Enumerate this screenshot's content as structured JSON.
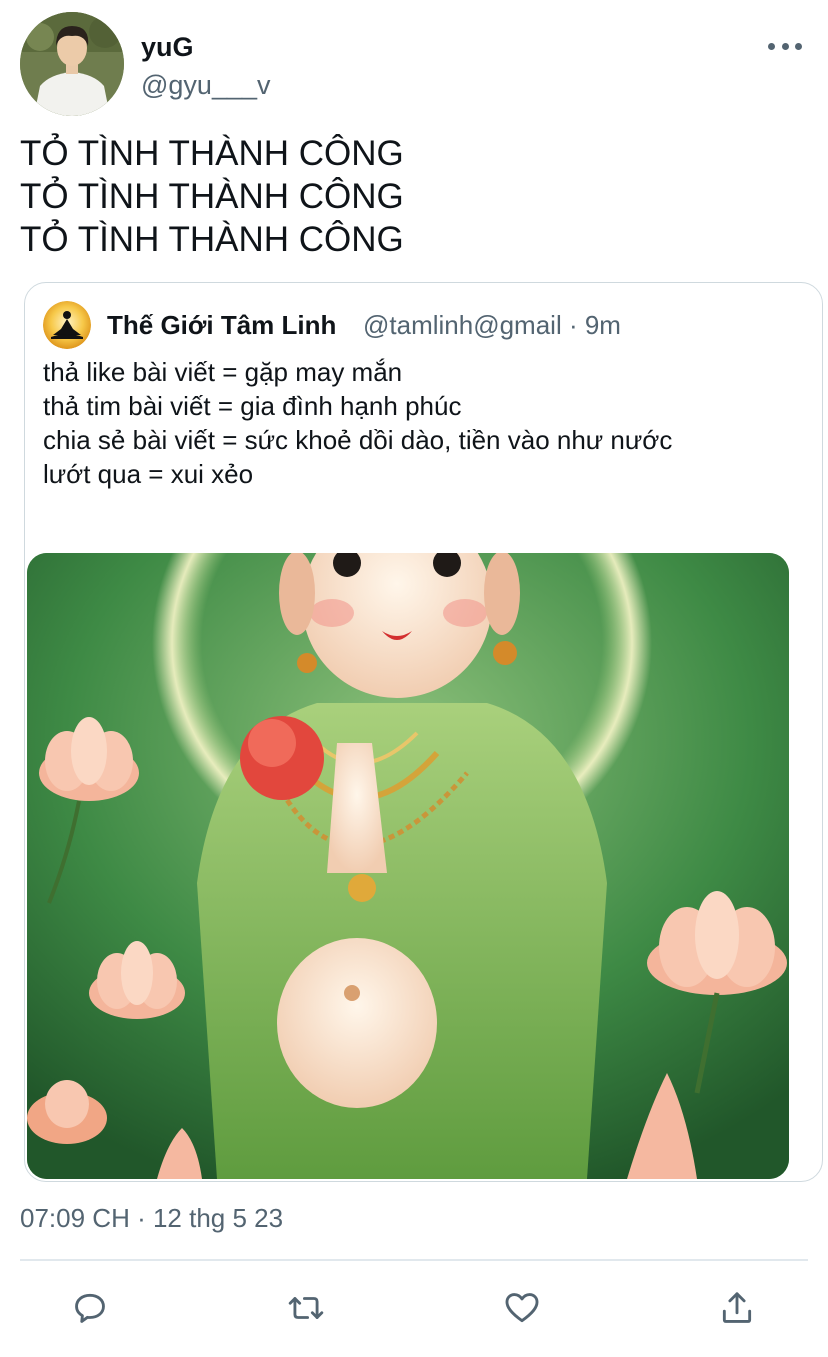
{
  "author": {
    "name": "yuG",
    "handle": "@gyu___v"
  },
  "tweet": {
    "lines": [
      "TỎ TÌNH THÀNH CÔNG",
      "TỎ TÌNH THÀNH CÔNG",
      "TỎ TÌNH THÀNH CÔNG"
    ]
  },
  "quoted": {
    "name": "Thế Giới Tâm Linh",
    "handle_time": "@tamlinh@gmail · 9m",
    "lines": [
      "thả like bài viết = gặp may mắn",
      "thả tim bài viết = gia đình hạnh phúc",
      "chia sẻ bài viết = sức khoẻ dồi dào, tiền vào như nước",
      "lướt qua = xui xẻo"
    ]
  },
  "timestamp": "07:09 CH · 12 thg 5 23",
  "icons": {
    "more": "more-horizontal-icon",
    "reply": "reply-icon",
    "retweet": "retweet-icon",
    "like": "heart-icon",
    "share": "share-icon"
  },
  "colors": {
    "text": "#0f1419",
    "secondary": "#536471",
    "border": "#cfd9de"
  }
}
